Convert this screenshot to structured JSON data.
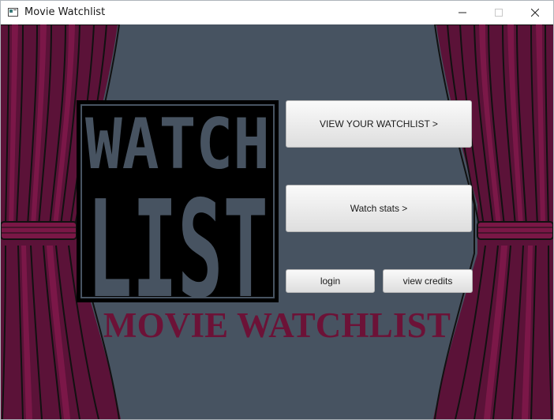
{
  "window": {
    "title": "Movie Watchlist",
    "controls": [
      "minimize-icon",
      "maximize-icon",
      "close-icon"
    ]
  },
  "logo": {
    "line1": "WATCH",
    "line2": "LIST"
  },
  "buttons": {
    "view_watchlist": "VIEW YOUR WATCHLIST >",
    "watch_stats": "Watch stats >",
    "login": "login",
    "view_credits": "view credits"
  },
  "main_title": "MOVIE WATCHLIST",
  "colors": {
    "background": "#475361",
    "curtain": "#7a1746",
    "title_text": "#6c1237",
    "button_face": "#e8e8e8"
  }
}
